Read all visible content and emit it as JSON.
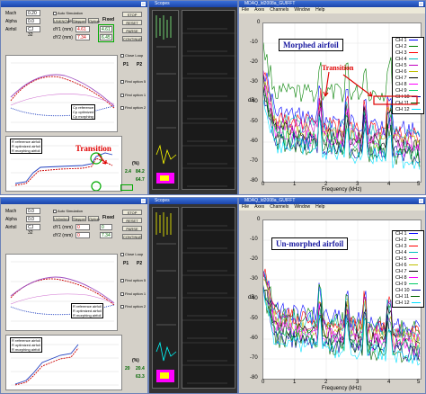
{
  "top": {
    "flow_window": {
      "fields": {
        "mach_label": "Mach",
        "mach_val": "0.20",
        "alpha_label": "Alpha",
        "alpha_val": "0.0",
        "airfoil_label": "Airfoil",
        "airfoil_val": "CJ 32"
      },
      "radio_auto": "Auto Simulation",
      "btn_row": [
        "UNKNOWN",
        "Stepper",
        "Option"
      ],
      "fixed_label": "Fixed",
      "d1_label": "dY1 (mm)",
      "d1_val": "4.61",
      "d1_val2": "4.61",
      "d2_label": "dY2 (mm)",
      "d2_val": "7.34",
      "d2_val2": "6.45",
      "right_btns": [
        "STOP",
        "RESET",
        "PARSE",
        "CONTINUE"
      ],
      "options": [
        "Close Loop",
        "Find option 5",
        "Find option 1",
        "Find option 2"
      ],
      "p_labels": [
        "P1",
        "P2"
      ],
      "legend": [
        "Cp reference",
        "Cp optimized",
        "Cp morphing"
      ],
      "legend2": [
        "R reference airfoil",
        "R optimized airfoil",
        "R morphing airfoil"
      ],
      "values": [
        "2.4",
        "84.2",
        "64.7"
      ],
      "cf_label": "(%)"
    },
    "dark_window_title": "Scopes",
    "fft": {
      "title": "MDAQ_ld2008a_GUIFFT",
      "menu": [
        "File",
        "Axes",
        "Channels",
        "Window",
        "Help"
      ],
      "annotation": "Morphed airfoil",
      "ylabel": "dB",
      "xlabel": "Frequency (kHz)",
      "yticks": [
        "0",
        "-10",
        "-20",
        "-30",
        "-40",
        "-50",
        "-60",
        "-70",
        "-80"
      ],
      "xticks": [
        "0",
        "1",
        "2",
        "3",
        "4",
        "5"
      ],
      "channels": [
        "CH 1",
        "CH 2",
        "CH 3",
        "CH 4",
        "CH 5",
        "CH 6",
        "CH 7",
        "CH 8",
        "CH 9",
        "CH 10",
        "CH 11",
        "CH 12"
      ]
    },
    "transition_fft": "Transition",
    "transition_plot": "Transition"
  },
  "bottom": {
    "flow_window": {
      "fields": {
        "mach_label": "Mach",
        "mach_val": "0.0",
        "alpha_label": "Alpha",
        "alpha_val": "0.0",
        "airfoil_label": "Airfoil",
        "airfoil_val": "CJ 32"
      },
      "radio_auto": "Auto Simulation",
      "btn_row": [
        "Unlimited",
        "Stepper",
        "Option"
      ],
      "fixed_label": "Fixed",
      "d1_label": "dY1 (mm)",
      "d1_val": "0",
      "d1_val2": "0",
      "d2_label": "dY2 (mm)",
      "d2_val": "0",
      "d2_val2": "7.34",
      "right_btns": [
        "STOP",
        "RESET",
        "PARSE",
        "CONTINUE"
      ],
      "options": [
        "Close Loop",
        "Find option 5",
        "Find option 1",
        "Find option 2"
      ],
      "p_labels": [
        "P1",
        "P2"
      ],
      "legend": [
        "R reference airfoil",
        "R optimized airfoil",
        "R morphing airfoil"
      ],
      "values": [
        "20",
        "20.4",
        "63.3"
      ],
      "cf_label": "(%)"
    },
    "dark_window_title": "Scopes",
    "fft": {
      "title": "MDAQ_ld2008a_GUIFFT",
      "menu": [
        "File",
        "Axes",
        "Channels",
        "Window",
        "Help"
      ],
      "annotation": "Un-morphed airfoil",
      "ylabel": "dB",
      "xlabel": "Frequency (kHz)",
      "yticks": [
        "0",
        "-10",
        "-20",
        "-30",
        "-40",
        "-50",
        "-60",
        "-70",
        "-80"
      ],
      "xticks": [
        "0",
        "1",
        "2",
        "3",
        "4",
        "5"
      ],
      "channels": [
        "CH 1",
        "CH 2",
        "CH 3",
        "CH 4",
        "CH 5",
        "CH 6",
        "CH 7",
        "CH 8",
        "CH 9",
        "CH 10",
        "CH 11",
        "CH 12"
      ]
    }
  },
  "colors": {
    "annotation_green": "#008000",
    "annotation_blue": "#1a1aa0",
    "transition_red": "#e00000",
    "channel_colors": [
      "#0000ff",
      "#008000",
      "#ff0000",
      "#00bfbf",
      "#bf00bf",
      "#bfbf00",
      "#000000",
      "#ff00ff",
      "#00cc66",
      "#0000a0",
      "#006400",
      "#00e0ff"
    ]
  }
}
